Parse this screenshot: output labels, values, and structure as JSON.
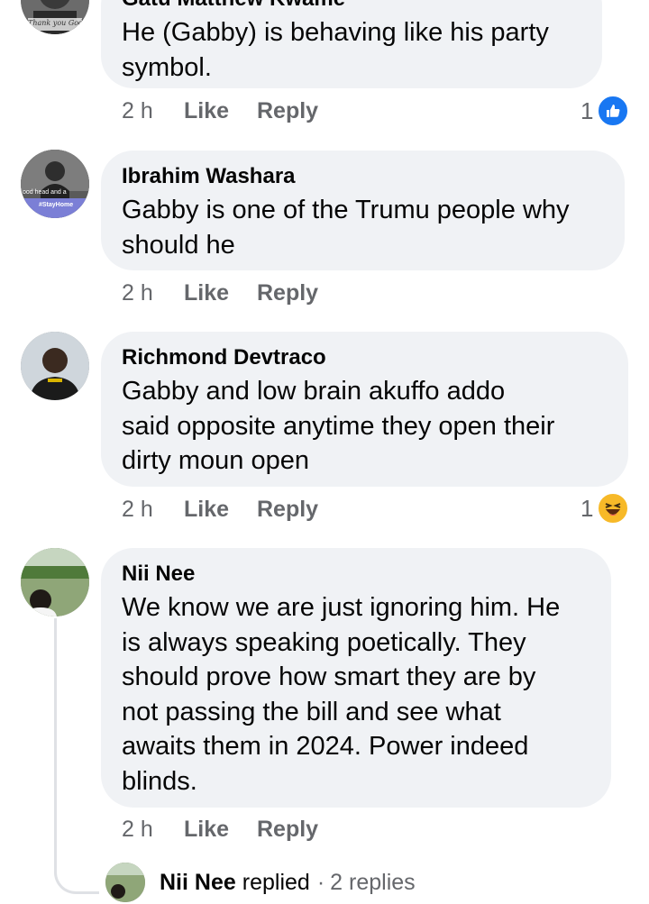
{
  "comments": [
    {
      "author": "Gatu Matthew Kwame",
      "text_lines": [
        "He (Gabby) is behaving like his party",
        "symbol."
      ],
      "avatar_caption": "Thank you God!",
      "time": "2 h",
      "like_label": "Like",
      "reply_label": "Reply",
      "reaction_count": "1",
      "reaction_icon": "like-thumbs-up-icon",
      "reaction_color": "#1877f2"
    },
    {
      "author": "Ibrahim Washara",
      "text_lines": [
        "Gabby is one of the Trumu people why",
        "should he"
      ],
      "avatar_caption": "ood head and a",
      "avatar_badge": "#StayHome",
      "time": "2 h",
      "like_label": "Like",
      "reply_label": "Reply"
    },
    {
      "author": "Richmond Devtraco",
      "text_lines": [
        "Gabby  and low brain akuffo  addo",
        "said opposite  anytime  they open their",
        "dirty moun open"
      ],
      "time": "2 h",
      "like_label": "Like",
      "reply_label": "Reply",
      "reaction_count": "1",
      "reaction_icon": "haha-laughing-emoji-icon",
      "reaction_color": "#f7b928"
    },
    {
      "author": "Nii Nee",
      "text_lines": [
        "We know we are just ignoring him. He",
        "is always speaking poetically. They",
        "should prove how smart they are by",
        "not passing the bill and see what",
        "awaits them in 2024. Power indeed",
        "blinds."
      ],
      "time": "2 h",
      "like_label": "Like",
      "reply_label": "Reply"
    }
  ],
  "replies_row": {
    "name": "Nii Nee",
    "action": "replied",
    "separator": "·",
    "count": "2 replies"
  },
  "colors": {
    "bubble": "#f0f2f5",
    "meta_text": "#65676b",
    "text": "#050505"
  }
}
